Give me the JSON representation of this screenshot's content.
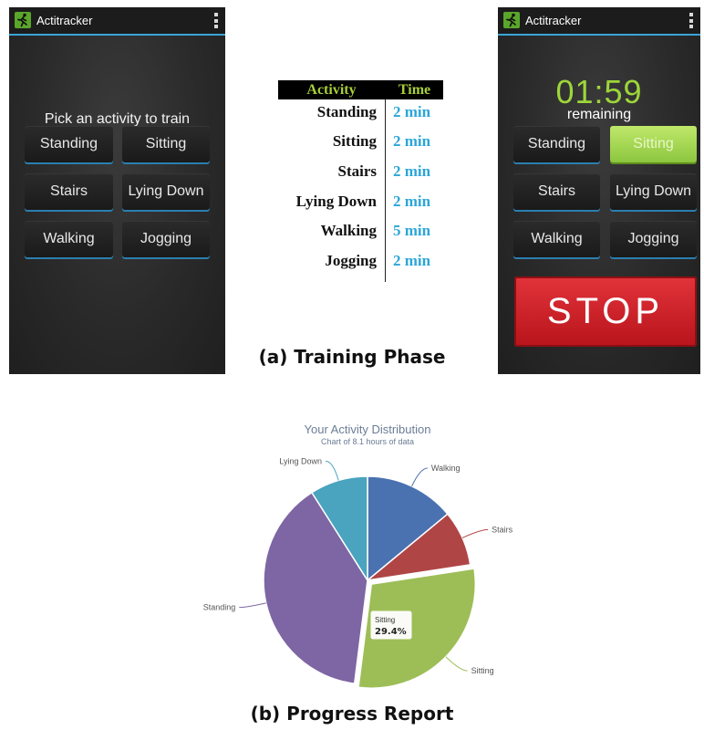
{
  "app": {
    "title": "Actitracker"
  },
  "training_screen": {
    "prompt": "Pick an activity to train",
    "buttons": [
      "Standing",
      "Sitting",
      "Stairs",
      "Lying Down",
      "Walking",
      "Jogging"
    ]
  },
  "schedule": {
    "headers": {
      "activity": "Activity",
      "time": "Time"
    },
    "rows": [
      {
        "activity": "Standing",
        "time": "2 min"
      },
      {
        "activity": "Sitting",
        "time": "2 min"
      },
      {
        "activity": "Stairs",
        "time": "2 min"
      },
      {
        "activity": "Lying Down",
        "time": "2 min"
      },
      {
        "activity": "Walking",
        "time": "5 min"
      },
      {
        "activity": "Jogging",
        "time": "2 min"
      }
    ]
  },
  "timer_screen": {
    "timer": "01:59",
    "remaining_label": "remaining",
    "buttons": [
      "Standing",
      "Sitting",
      "Stairs",
      "Lying Down",
      "Walking",
      "Jogging"
    ],
    "selected": "Sitting",
    "stop_label": "STOP"
  },
  "captions": {
    "a": "(a) Training Phase",
    "b": "(b) Progress Report"
  },
  "colors": {
    "accent_blue": "#3aa5d8",
    "timer_green": "#9dd63a",
    "stop_red": "#d42a32",
    "walking": "#4a72b0",
    "stairs": "#b04545",
    "sitting": "#9dbe57",
    "standing": "#7d66a3",
    "lying_down": "#4aa3bf"
  },
  "chart_data": {
    "type": "pie",
    "title": "Your Activity Distribution",
    "subtitle": "Chart of 8.1 hours of data",
    "slices": [
      {
        "name": "Walking",
        "value": 14.0,
        "color": "#4a72b0"
      },
      {
        "name": "Stairs",
        "value": 8.6,
        "color": "#b04545"
      },
      {
        "name": "Sitting",
        "value": 29.4,
        "color": "#9dbe57"
      },
      {
        "name": "Standing",
        "value": 39.0,
        "color": "#7d66a3"
      },
      {
        "name": "Lying Down",
        "value": 9.0,
        "color": "#4aa3bf"
      }
    ],
    "tooltip": {
      "label": "Sitting",
      "value": "29.4%"
    }
  }
}
